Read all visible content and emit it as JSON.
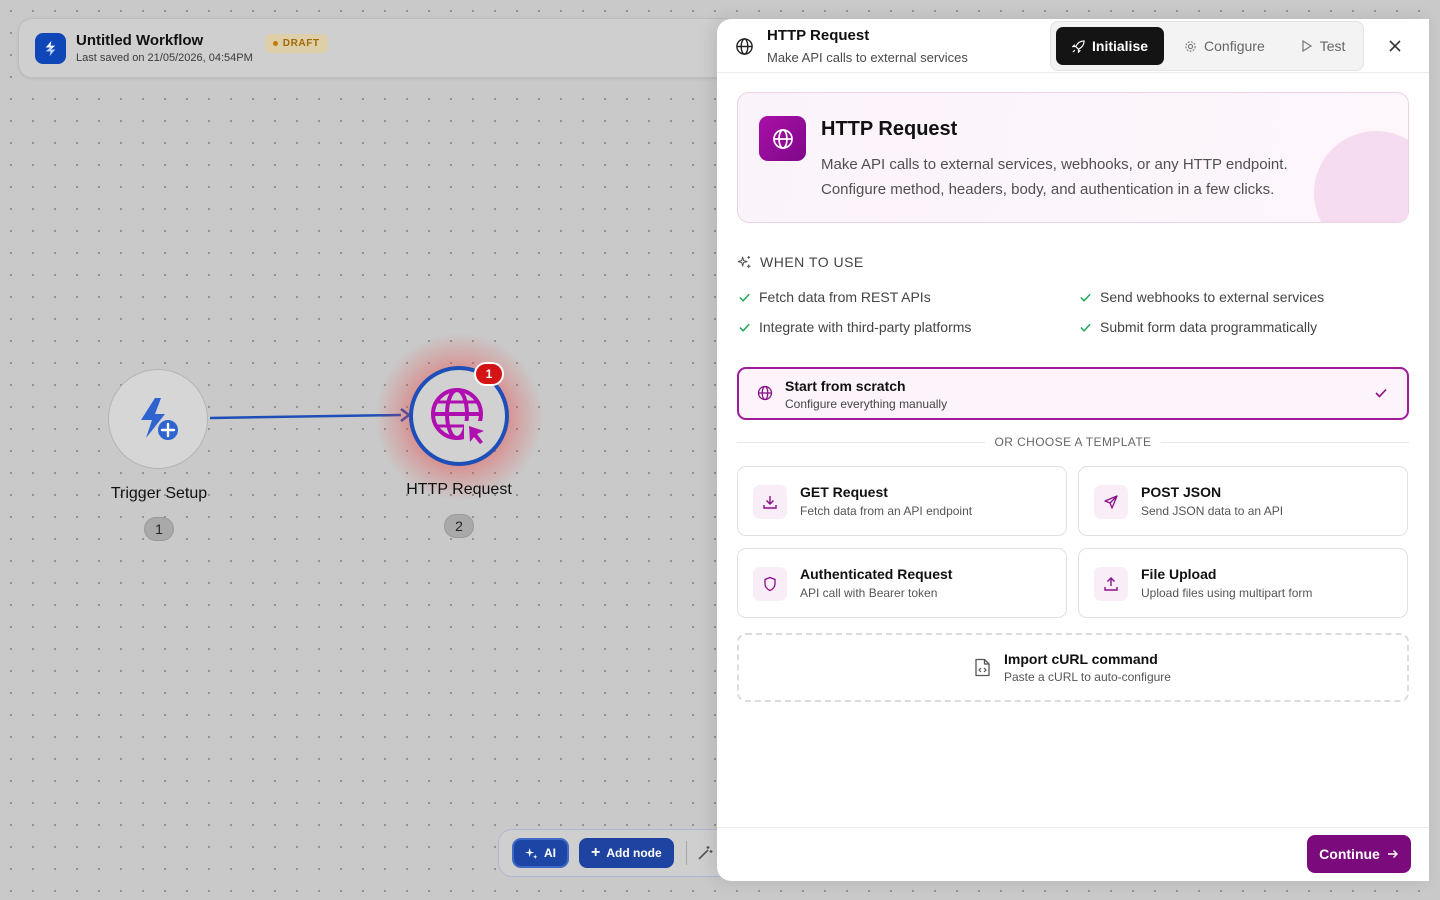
{
  "workflow": {
    "title": "Untitled Workflow",
    "saved": "Last saved on 21/05/2026, 04:54PM",
    "status": "DRAFT"
  },
  "nodes": [
    {
      "label": "Trigger Setup",
      "step": "1",
      "icon": "lightning-plus-icon"
    },
    {
      "label": "HTTP Request",
      "step": "2",
      "icon": "globe-cursor-icon",
      "badge": "1"
    }
  ],
  "toolbar": {
    "ai_label": "AI",
    "add_label": "Add node"
  },
  "panel": {
    "title": "HTTP Request",
    "subtitle": "Make API calls to external services",
    "tabs": [
      {
        "label": "Initialise",
        "icon": "rocket-icon",
        "active": true
      },
      {
        "label": "Configure",
        "icon": "gear-icon",
        "active": false
      },
      {
        "label": "Test",
        "icon": "play-icon",
        "active": false
      }
    ],
    "hero": {
      "title": "HTTP Request",
      "desc_line1": "Make API calls to external services, webhooks, or any HTTP endpoint.",
      "desc_line2": "Configure method, headers, body, and authentication in a few clicks."
    },
    "when_to_use": {
      "heading": "WHEN TO USE",
      "items": [
        "Fetch data from REST APIs",
        "Send webhooks to external services",
        "Integrate with third-party platforms",
        "Submit form data programmatically"
      ]
    },
    "scratch": {
      "title": "Start from scratch",
      "subtitle": "Configure everything manually"
    },
    "divider_text": "OR CHOOSE A TEMPLATE",
    "templates": [
      {
        "title": "GET Request",
        "subtitle": "Fetch data from an API endpoint",
        "icon": "download-icon"
      },
      {
        "title": "POST JSON",
        "subtitle": "Send JSON data to an API",
        "icon": "send-icon"
      },
      {
        "title": "Authenticated Request",
        "subtitle": "API call with Bearer token",
        "icon": "shield-icon"
      },
      {
        "title": "File Upload",
        "subtitle": "Upload files using multipart form",
        "icon": "upload-icon"
      }
    ],
    "curl": {
      "title": "Import cURL command",
      "subtitle": "Paste a cURL to auto-configure"
    },
    "continue_label": "Continue"
  },
  "colors": {
    "accent": "#7b0a7c",
    "node_blue": "#1e4fb8",
    "alert_red": "#d41414"
  }
}
